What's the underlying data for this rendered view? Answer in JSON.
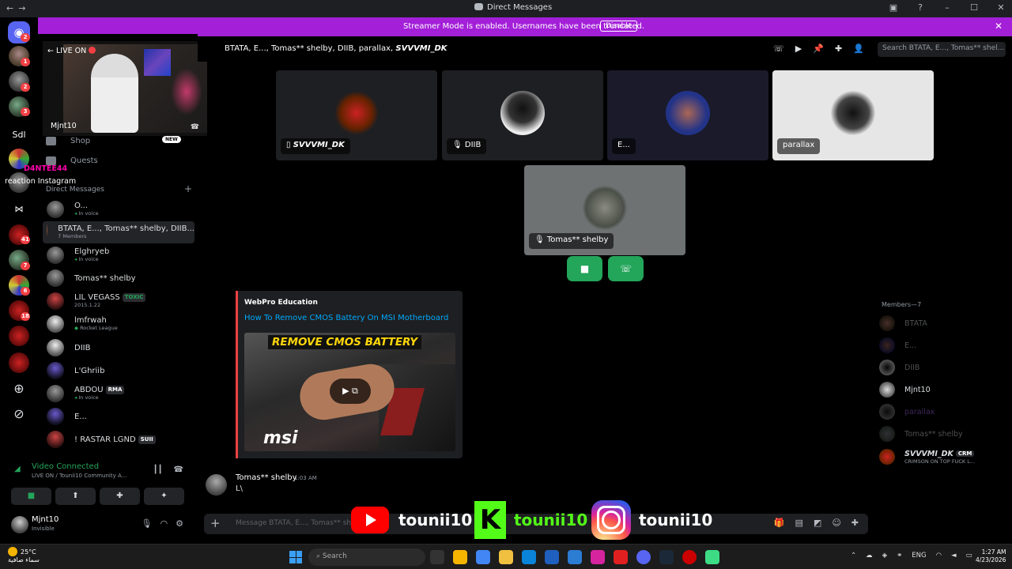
{
  "window": {
    "title": "Direct Messages"
  },
  "banner": {
    "message": "Streamer Mode is enabled. Usernames have been truncated.",
    "disable_label": "Disable"
  },
  "guilds": {
    "badges": [
      "2",
      "1",
      "2",
      "3",
      "41",
      "7",
      "6",
      "18"
    ],
    "server_text": "Sdl"
  },
  "pip": {
    "live_label": "LIVE ON",
    "name": "Mjnt10"
  },
  "overlay": {
    "streamer": "D4NTEE44",
    "reaction": "reaction Instagram"
  },
  "sidebar": {
    "shop": "Shop",
    "new_badge": "NEW",
    "quests": "Quests",
    "dm_header": "Direct Messages",
    "dms": [
      {
        "name": "O...",
        "sub": "In voice"
      },
      {
        "name": "BTATA, E..., Tomas** shelby, DIIB...",
        "sub": "7 Members"
      },
      {
        "name": "Elghryeb",
        "sub": "In voice"
      },
      {
        "name": "Tomas** shelby",
        "sub": ""
      },
      {
        "name": "LIL VEGASS",
        "tag": "TOXIC",
        "sub": "2015.1.22"
      },
      {
        "name": "lmfrwah",
        "sub": "Rocket League"
      },
      {
        "name": "DIIB",
        "sub": ""
      },
      {
        "name": "L'Ghriib",
        "sub": ""
      },
      {
        "name": "ABDOU",
        "tag": "RMA",
        "sub": "In voice"
      },
      {
        "name": "E...",
        "sub": ""
      },
      {
        "name": "! RASTAR LGND",
        "tag": "SUII",
        "sub": ""
      }
    ]
  },
  "voice": {
    "status": "Video Connected",
    "channel": "LIVE ON / Tounii10 Community A..."
  },
  "user": {
    "name": "Mjnt10",
    "status": "Invisible"
  },
  "call": {
    "header_title": "BTATA, E..., Tomas** shelby, DIIB, parallax,",
    "header_title_bold": "SVVVMI_DK",
    "search_placeholder": "Search BTATA, E..., Tomas** shel...",
    "tiles": [
      {
        "label": "SVVVMI_DK"
      },
      {
        "label": "DIIB"
      },
      {
        "label": "E..."
      },
      {
        "label": "parallax"
      },
      {
        "label": "Tomas** shelby"
      }
    ]
  },
  "embed": {
    "provider": "WebPro Education",
    "title": "How To Remove CMOS Battery On MSI Motherboard",
    "thumb_caption": "REMOVE CMOS BATTERY",
    "thumb_logo": "msi"
  },
  "message": {
    "author": "Tomas** shelby",
    "time": "1:03 AM",
    "text": "L\\"
  },
  "composer": {
    "placeholder": "Message BTATA, E..., Tomas** sh"
  },
  "social": {
    "youtube": "tounii10",
    "kick": "tounii10",
    "instagram": "tounii10",
    "kick_letter": "K"
  },
  "members": {
    "header": "Members—7",
    "list": [
      {
        "name": "BTATA",
        "dim": true
      },
      {
        "name": "E...",
        "dim": true
      },
      {
        "name": "DIIB",
        "dim": true
      },
      {
        "name": "Mjnt10",
        "dim": false
      },
      {
        "name": "parallax",
        "dim": true
      },
      {
        "name": "Tomas** shelby",
        "dim": true
      },
      {
        "name": "SVVVMI_DK",
        "tag": "CRM",
        "sub": "CRIMSON ON TOP FUCK L...",
        "dim": false
      }
    ]
  },
  "taskbar": {
    "temp": "25°C",
    "weather": "سماء صافية",
    "search": "Search",
    "lang": "ENG",
    "time": "1:27 AM",
    "date": "4/23/2026"
  }
}
